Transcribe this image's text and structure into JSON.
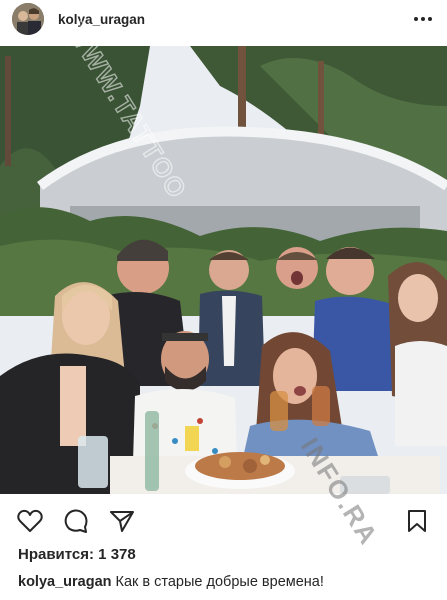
{
  "post": {
    "username": "kolya_uragan",
    "likes_text": "Нравится: 1 378",
    "caption_user": "kolya_uragan",
    "caption_text": " Как в старые добрые времена!"
  },
  "icons": {
    "header": [
      "avatar",
      "more-horizontal-icon"
    ],
    "actions": [
      "heart-icon",
      "comment-icon",
      "share-icon",
      "bookmark-icon"
    ]
  },
  "watermark": {
    "text_upper": "WWW.TATTOO",
    "text_lower": "INFO.RA"
  }
}
